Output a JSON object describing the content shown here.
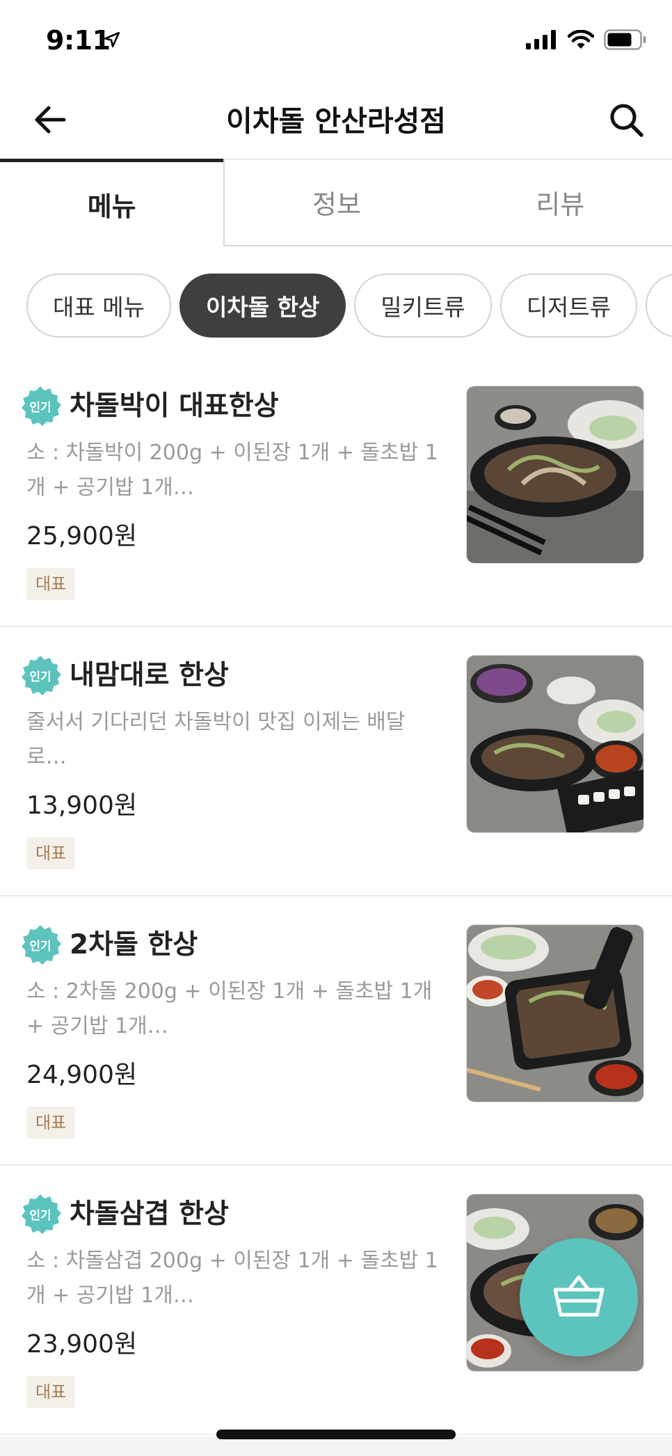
{
  "status_bar": {
    "time": "9:11",
    "icons": [
      "location-arrow-icon",
      "signal-icon",
      "wifi-icon",
      "battery-icon"
    ]
  },
  "header": {
    "title": "이차돌 안산라성점",
    "back_icon": "arrow-left-icon",
    "search_icon": "search-icon"
  },
  "tabs": [
    {
      "label": "메뉴",
      "active": true
    },
    {
      "label": "정보",
      "active": false
    },
    {
      "label": "리뷰",
      "active": false
    }
  ],
  "categories": [
    {
      "label": "대표 메뉴",
      "selected": false
    },
    {
      "label": "이차돌 한상",
      "selected": true
    },
    {
      "label": "밀키트류",
      "selected": false
    },
    {
      "label": "디저트류",
      "selected": false
    }
  ],
  "menu_items": [
    {
      "badge": "인기",
      "name": "차돌박이 대표한상",
      "description": "소 : 차돌박이 200g + 이된장 1개 + 돌초밥 1개 + 공기밥 1개…",
      "price": "25,900원",
      "tag": "대표"
    },
    {
      "badge": "인기",
      "name": "내맘대로 한상",
      "description": "줄서서 기다리던 차돌박이 맛집 이제는 배달로…",
      "price": "13,900원",
      "tag": "대표"
    },
    {
      "badge": "인기",
      "name": "2차돌 한상",
      "description": "소 : 2차돌 200g + 이된장 1개 + 돌초밥 1개 + 공기밥 1개…",
      "price": "24,900원",
      "tag": "대표"
    },
    {
      "badge": "인기",
      "name": "차돌삼겹 한상",
      "description": "소 : 차돌삼겹 200g + 이된장 1개 + 돌초밥 1개 + 공기밥 1개…",
      "price": "23,900원",
      "tag": "대표"
    }
  ],
  "cart": {
    "icon": "basket-icon"
  },
  "colors": {
    "accent": "#5cc3bd",
    "chip_selected": "#3f3f3f",
    "tag_bg": "#f4efe9",
    "tag_text": "#a27d52"
  }
}
